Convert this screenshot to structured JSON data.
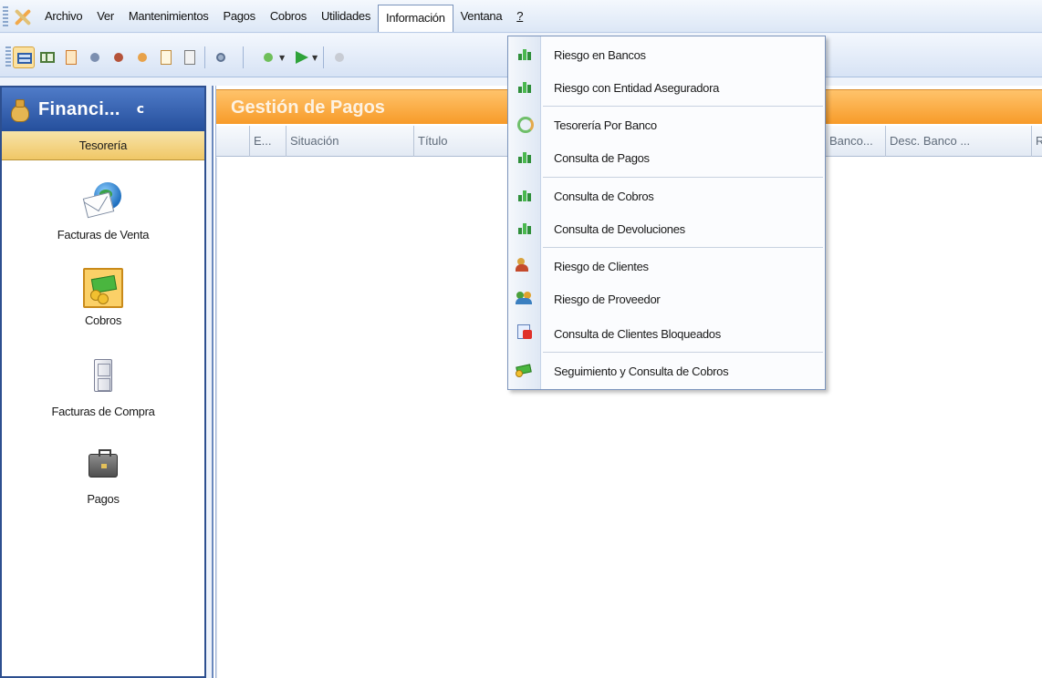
{
  "menubar": {
    "items": [
      {
        "label": "Archivo"
      },
      {
        "label": "Ver"
      },
      {
        "label": "Mantenimientos"
      },
      {
        "label": "Pagos"
      },
      {
        "label": "Cobros"
      },
      {
        "label": "Utilidades"
      },
      {
        "label": "Información"
      },
      {
        "label": "Ventana"
      },
      {
        "label": "?"
      }
    ],
    "active": "Información"
  },
  "toolbar": {
    "icons": [
      "view-list-icon",
      "view-split-icon",
      "document-icon",
      "tool-icon",
      "tool-icon",
      "refresh-icon",
      "page-icon",
      "checklist-icon",
      "search-icon",
      "download-icon",
      "play-icon",
      "export-icon"
    ]
  },
  "left_panel": {
    "title": "Financi...",
    "pin": "c",
    "section": "Tesorería",
    "items": [
      {
        "label": "Facturas de Venta",
        "icon": "envelope-globe-icon"
      },
      {
        "label": "Cobros",
        "icon": "money-icon",
        "selected": true
      },
      {
        "label": "Facturas de Compra",
        "icon": "file-cabinet-icon"
      },
      {
        "label": "Pagos",
        "icon": "briefcase-icon"
      }
    ]
  },
  "main": {
    "title": "Gestión de Pagos",
    "columns": [
      {
        "label": "E..."
      },
      {
        "label": "Situación"
      },
      {
        "label": "Título"
      },
      {
        "label": "Banco..."
      },
      {
        "label": "Desc. Banco ..."
      },
      {
        "label": "R"
      }
    ]
  },
  "dropdown": {
    "items": [
      {
        "label": "Riesgo en Bancos",
        "icon": "chart-icon"
      },
      {
        "label": "Riesgo con Entidad Aseguradora",
        "icon": "chart-icon"
      },
      {
        "label": "Tesorería Por Banco",
        "icon": "refresh-icon"
      },
      {
        "label": "Consulta de Pagos",
        "icon": "chart-icon"
      },
      {
        "label": "Consulta de Cobros",
        "icon": "chart-icon"
      },
      {
        "label": "Consulta de Devoluciones",
        "icon": "chart-icon"
      },
      {
        "label": "Riesgo de Clientes",
        "icon": "users-icon"
      },
      {
        "label": "Riesgo de Proveedor",
        "icon": "users-pair-icon"
      },
      {
        "label": "Consulta de Clientes Bloqueados",
        "icon": "blocked-icon"
      },
      {
        "label": "Seguimiento y Consulta de Cobros",
        "icon": "money-icon"
      }
    ]
  },
  "colors": {
    "accent_orange": "#f79b29",
    "nav_blue": "#254f9c",
    "selection_gold": "#fbd067"
  }
}
